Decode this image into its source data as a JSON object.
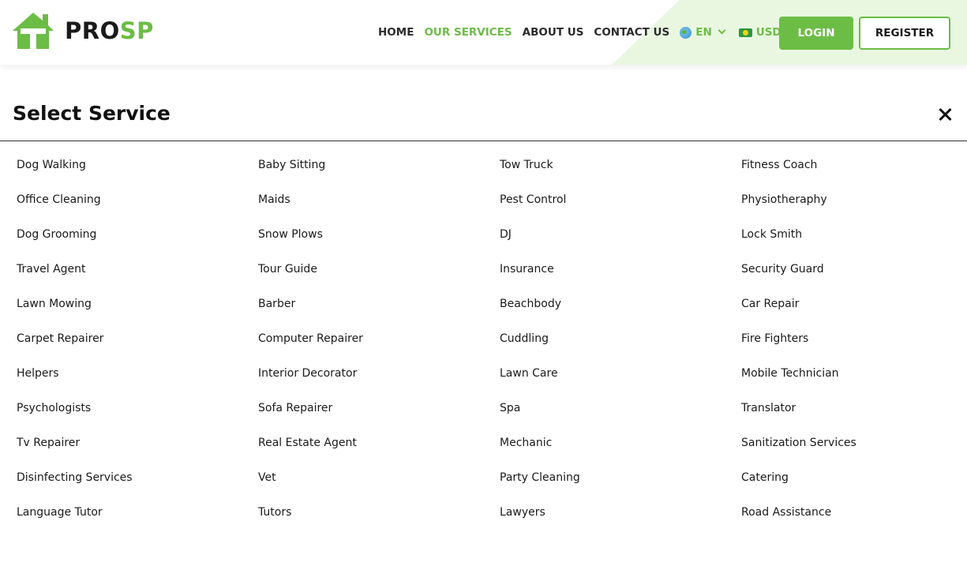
{
  "brand": {
    "name_part1": "PRO",
    "name_part2": "SP",
    "accent_color": "#6cbd45"
  },
  "nav": {
    "items": [
      {
        "label": "HOME",
        "active": false
      },
      {
        "label": "OUR SERVICES",
        "active": true
      },
      {
        "label": "ABOUT US",
        "active": false
      },
      {
        "label": "CONTACT US",
        "active": false
      }
    ],
    "language": {
      "label": "EN",
      "icon": "globe-icon"
    },
    "currency": {
      "label": "USD",
      "icon": "flag-icon"
    },
    "login_label": "LOGIN",
    "register_label": "REGISTER"
  },
  "modal": {
    "title": "Select Service",
    "close_icon": "close-icon",
    "columns": [
      [
        "Dog Walking",
        "Office Cleaning",
        "Dog Grooming",
        "Travel Agent",
        "Lawn Mowing",
        "Carpet Repairer",
        "Helpers",
        "Psychologists",
        "Tv Repairer",
        "Disinfecting Services",
        "Language Tutor"
      ],
      [
        "Baby Sitting",
        "Maids",
        "Snow Plows",
        "Tour Guide",
        "Barber",
        "Computer Repairer",
        "Interior Decorator",
        "Sofa Repairer",
        "Real Estate Agent",
        "Vet",
        "Tutors"
      ],
      [
        "Tow Truck",
        "Pest Control",
        "DJ",
        "Insurance",
        "Beachbody",
        "Cuddling",
        "Lawn Care",
        "Spa",
        "Mechanic",
        "Party Cleaning",
        "Lawyers"
      ],
      [
        "Fitness Coach",
        "Physiotheraphy",
        "Lock Smith",
        "Security Guard",
        "Car Repair",
        "Fire Fighters",
        "Mobile Technician",
        "Translator",
        "Sanitization Services",
        "Catering",
        "Road Assistance"
      ]
    ]
  }
}
